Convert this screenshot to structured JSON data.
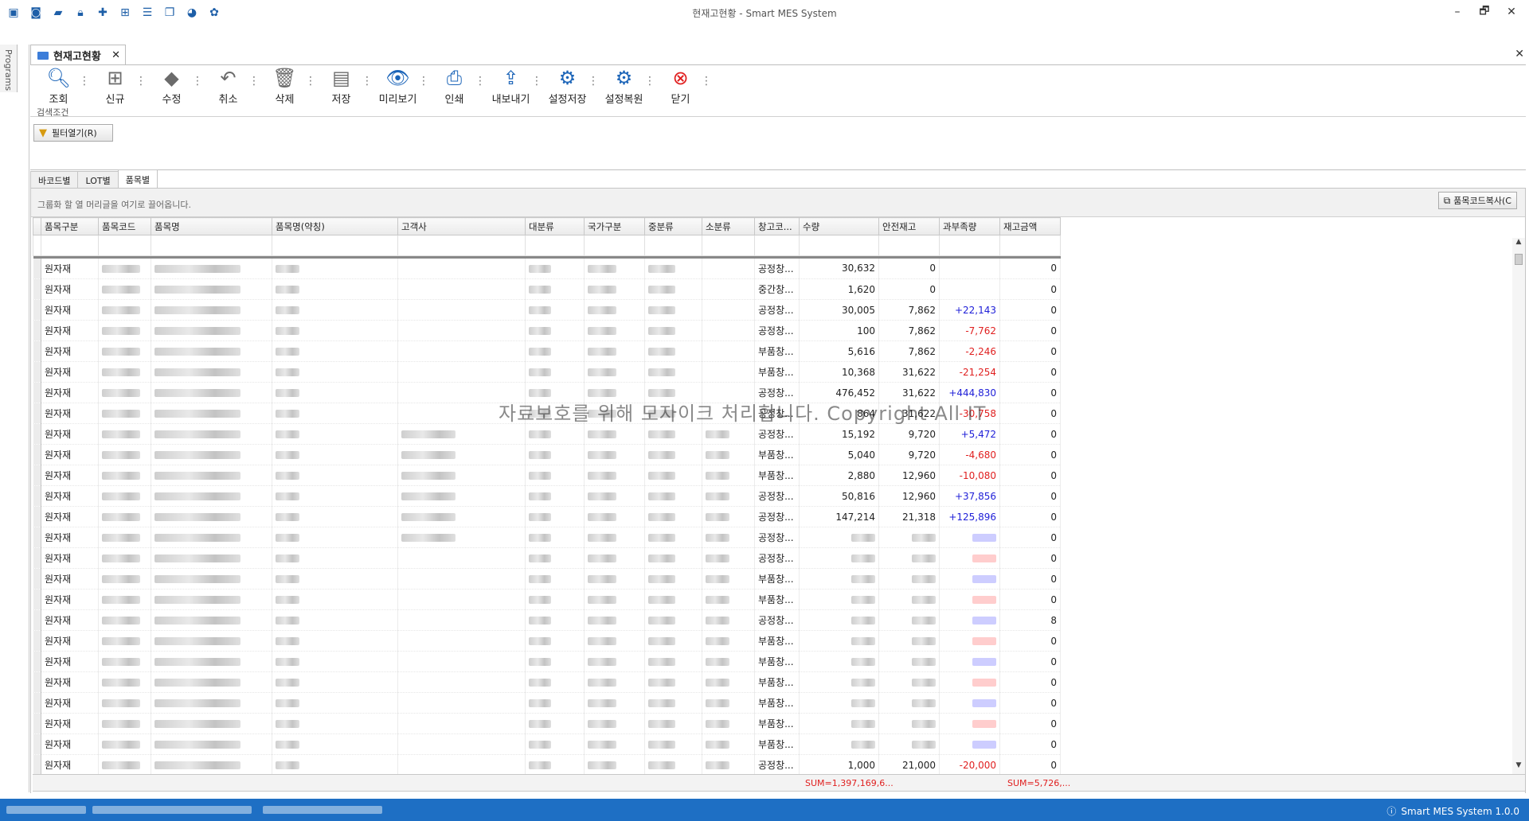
{
  "window": {
    "title": "현재고현황 - Smart MES System",
    "minimize": "–",
    "restore": "🗗",
    "close": "✕"
  },
  "quick_access_icons": [
    "app-icon",
    "camera-icon",
    "folder-icon",
    "lock-icon",
    "plus-shield-icon",
    "hierarchy-icon",
    "list-icon",
    "windows-icon",
    "palette-icon",
    "palette2-icon"
  ],
  "side_strip": {
    "label": "Programs"
  },
  "doc_tab": {
    "label": "현재고현황",
    "close": "✕"
  },
  "close_all": "✕",
  "toolbar": {
    "search": "조회",
    "new": "신규",
    "edit": "수정",
    "cancel": "취소",
    "delete": "삭제",
    "save": "저장",
    "preview": "미리보기",
    "print": "인쇄",
    "export": "내보내기",
    "save_settings": "설정저장",
    "restore_settings": "설정복원",
    "close": "닫기"
  },
  "search_panel": {
    "title": "검색조건",
    "filter_button": "필터열기(R)"
  },
  "subtabs": [
    "바코드별",
    "LOT별",
    "품목별"
  ],
  "active_subtab": "품목별",
  "grid": {
    "group_hint": "그룹화 할 열 머리글을 여기로 끌어옵니다.",
    "copy_button": "품목코드복사(C",
    "columns": [
      "품목구분",
      "품목코드",
      "품목명",
      "품목명(약칭)",
      "고객사",
      "대분류",
      "국가구분",
      "중분류",
      "소분류",
      "창고코...",
      "수량",
      "안전재고",
      "과부족량",
      "재고금액"
    ],
    "rows": [
      {
        "type": "원자재",
        "wh": "공정창...",
        "qty": "30,632",
        "safety": "0",
        "diff": "",
        "amount": "0"
      },
      {
        "type": "원자재",
        "wh": "중간창...",
        "qty": "1,620",
        "safety": "0",
        "diff": "",
        "amount": "0"
      },
      {
        "type": "원자재",
        "wh": "공정창...",
        "qty": "30,005",
        "safety": "7,862",
        "diff": "+22,143",
        "amount": "0"
      },
      {
        "type": "원자재",
        "wh": "공정창...",
        "qty": "100",
        "safety": "7,862",
        "diff": "-7,762",
        "amount": "0"
      },
      {
        "type": "원자재",
        "wh": "부품창...",
        "qty": "5,616",
        "safety": "7,862",
        "diff": "-2,246",
        "amount": "0"
      },
      {
        "type": "원자재",
        "wh": "부품창...",
        "qty": "10,368",
        "safety": "31,622",
        "diff": "-21,254",
        "amount": "0"
      },
      {
        "type": "원자재",
        "wh": "공정창...",
        "qty": "476,452",
        "safety": "31,622",
        "diff": "+444,830",
        "amount": "0"
      },
      {
        "type": "원자재",
        "wh": "공정창...",
        "qty": "864",
        "safety": "31,622",
        "diff": "-30,758",
        "amount": "0"
      },
      {
        "type": "원자재",
        "wh": "공정창...",
        "qty": "15,192",
        "safety": "9,720",
        "diff": "+5,472",
        "amount": "0"
      },
      {
        "type": "원자재",
        "wh": "부품창...",
        "qty": "5,040",
        "safety": "9,720",
        "diff": "-4,680",
        "amount": "0"
      },
      {
        "type": "원자재",
        "wh": "부품창...",
        "qty": "2,880",
        "safety": "12,960",
        "diff": "-10,080",
        "amount": "0"
      },
      {
        "type": "원자재",
        "wh": "공정창...",
        "qty": "50,816",
        "safety": "12,960",
        "diff": "+37,856",
        "amount": "0"
      },
      {
        "type": "원자재",
        "wh": "공정창...",
        "qty": "147,214",
        "safety": "21,318",
        "diff": "+125,896",
        "amount": "0"
      },
      {
        "type": "원자재",
        "wh": "공정창...",
        "qty": "",
        "safety": "",
        "diff": "",
        "amount": "0"
      },
      {
        "type": "원자재",
        "wh": "공정창...",
        "qty": "",
        "safety": "",
        "diff": "",
        "amount": "0"
      },
      {
        "type": "원자재",
        "wh": "부품창...",
        "qty": "",
        "safety": "",
        "diff": "",
        "amount": "0"
      },
      {
        "type": "원자재",
        "wh": "부품창...",
        "qty": "",
        "safety": "",
        "diff": "",
        "amount": "0"
      },
      {
        "type": "원자재",
        "wh": "공정창...",
        "qty": "",
        "safety": "",
        "diff": "",
        "amount": "8"
      },
      {
        "type": "원자재",
        "wh": "부품창...",
        "qty": "",
        "safety": "",
        "diff": "",
        "amount": "0"
      },
      {
        "type": "원자재",
        "wh": "부품창...",
        "qty": "",
        "safety": "",
        "diff": "",
        "amount": "0"
      },
      {
        "type": "원자재",
        "wh": "부품창...",
        "qty": "",
        "safety": "",
        "diff": "",
        "amount": "0"
      },
      {
        "type": "원자재",
        "wh": "부품창...",
        "qty": "",
        "safety": "",
        "diff": "",
        "amount": "0"
      },
      {
        "type": "원자재",
        "wh": "부품창...",
        "qty": "",
        "safety": "",
        "diff": "",
        "amount": "0"
      },
      {
        "type": "원자재",
        "wh": "부품창...",
        "qty": "",
        "safety": "",
        "diff": "",
        "amount": "0"
      },
      {
        "type": "원자재",
        "wh": "공정창...",
        "qty": "1,000",
        "safety": "21,000",
        "diff": "-20,000",
        "amount": "0"
      }
    ],
    "sum_qty": "SUM=1,397,169,6...",
    "sum_amount": "SUM=5,726,..."
  },
  "watermark": "자료보호를 위해 모자이크 처리합니다. Copyright All IT",
  "status": {
    "app_version": "Smart MES System 1.0.0"
  }
}
